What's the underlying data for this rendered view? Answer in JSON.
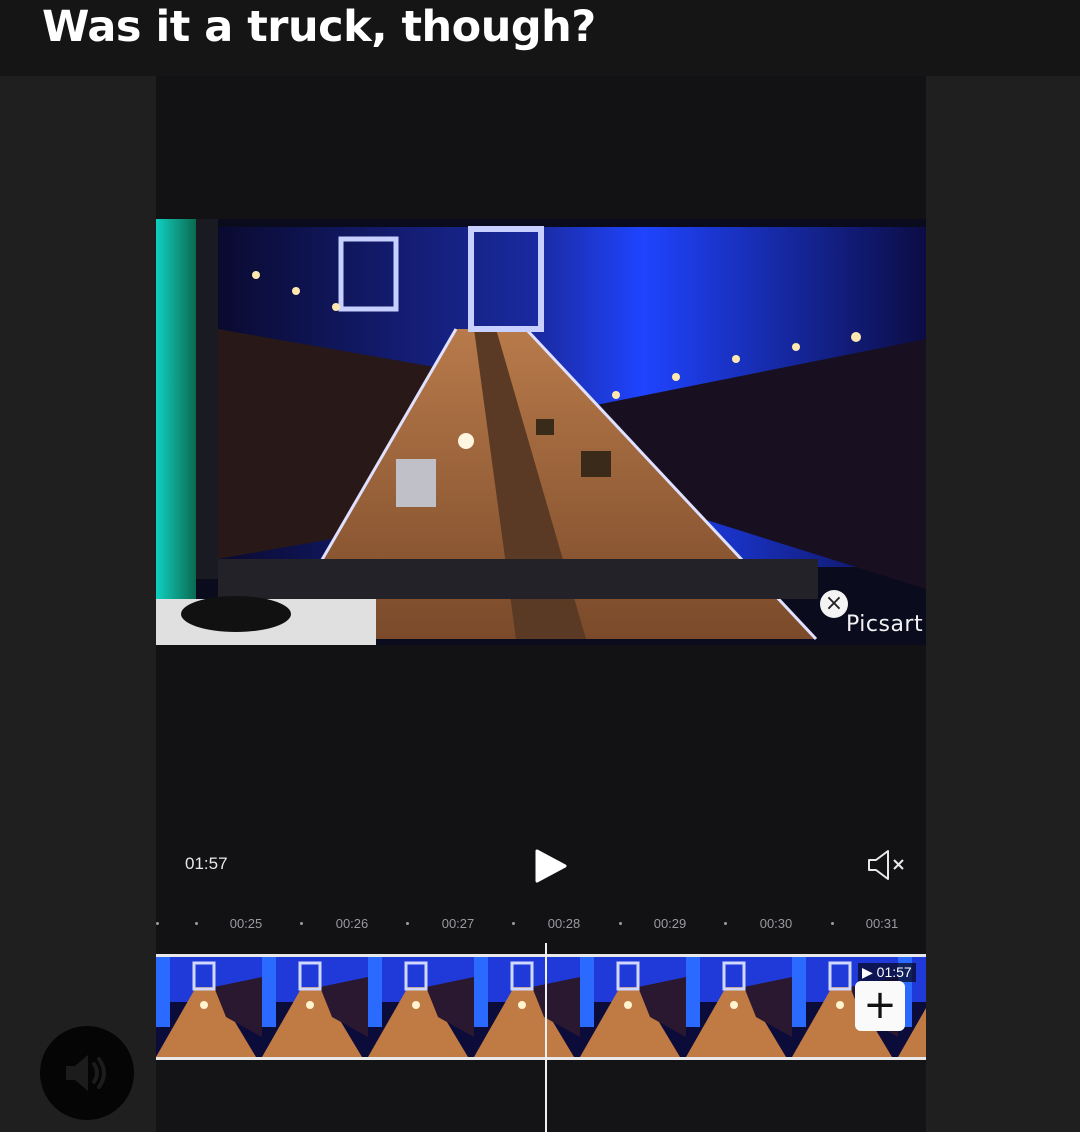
{
  "header": {
    "title": "Was it a truck, though?"
  },
  "preview": {
    "watermark_close_glyph": "×",
    "watermark_text": "Picsart"
  },
  "controls": {
    "current_time": "01:57",
    "play_icon": "play-icon",
    "mute_icon": "speaker-muted-icon"
  },
  "timeline": {
    "ruler_labels": [
      "00:25",
      "00:26",
      "00:27",
      "00:28",
      "00:29",
      "00:30",
      "00:31"
    ],
    "clip_duration": "▶ 01:57",
    "add_clip_glyph": "+",
    "frame_count": 8
  },
  "audio_fab": {
    "icon": "speaker-icon"
  },
  "colors": {
    "header_bg": "#151515",
    "editor_bg": "#121214",
    "side_bg": "#1f1f20",
    "accent_white": "#ffffff"
  }
}
